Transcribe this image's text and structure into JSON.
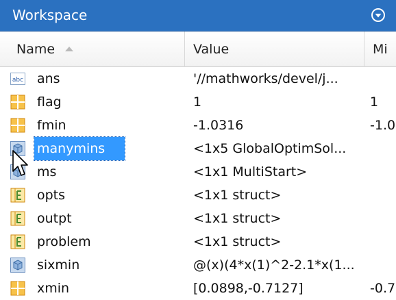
{
  "panel": {
    "title": "Workspace",
    "colors": {
      "title_bar": "#2b71c0",
      "selection": "#3399ff"
    }
  },
  "columns": {
    "name": "Name",
    "value": "Value",
    "min": "Mi"
  },
  "rows": [
    {
      "icon": "char-array-icon",
      "name": "ans",
      "value": "'//mathworks/devel/j...",
      "min": ""
    },
    {
      "icon": "numeric-matrix-icon",
      "name": "flag",
      "value": "1",
      "min": "1"
    },
    {
      "icon": "numeric-matrix-icon",
      "name": "fmin",
      "value": "-1.0316",
      "min": "-1.0"
    },
    {
      "icon": "object-icon",
      "name": "manymins",
      "value": "<1x5 GlobalOptimSol...",
      "min": "",
      "selected": true
    },
    {
      "icon": "object-icon",
      "name": "ms",
      "value": "<1x1 MultiStart>",
      "min": ""
    },
    {
      "icon": "struct-icon",
      "name": "opts",
      "value": "<1x1 struct>",
      "min": ""
    },
    {
      "icon": "struct-icon",
      "name": "outpt",
      "value": "<1x1 struct>",
      "min": ""
    },
    {
      "icon": "struct-icon",
      "name": "problem",
      "value": "<1x1 struct>",
      "min": ""
    },
    {
      "icon": "object-icon",
      "name": "sixmin",
      "value": "@(x)(4*x(1)^2-2.1*x(1...",
      "min": ""
    },
    {
      "icon": "numeric-matrix-icon",
      "name": "xmin",
      "value": "[0.0898,-0.7127]",
      "min": "-0.7"
    }
  ]
}
